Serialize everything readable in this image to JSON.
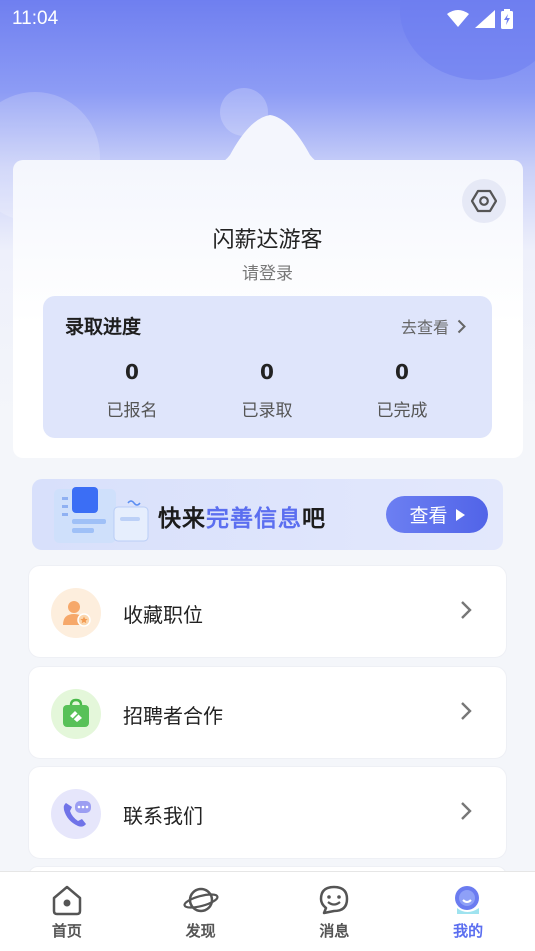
{
  "status_bar": {
    "time": "11:04"
  },
  "profile": {
    "username": "闪薪达游客",
    "login_hint": "请登录"
  },
  "progress": {
    "title": "录取进度",
    "link_label": "去查看",
    "stats": [
      {
        "value": "0",
        "label": "已报名"
      },
      {
        "value": "0",
        "label": "已录取"
      },
      {
        "value": "0",
        "label": "已完成"
      }
    ]
  },
  "banner": {
    "text_prefix": "快来",
    "text_highlight": "完善信息",
    "text_suffix": "吧",
    "button_label": "查看"
  },
  "menu": [
    {
      "label": "收藏职位",
      "icon": "person-star-icon"
    },
    {
      "label": "招聘者合作",
      "icon": "handshake-bag-icon"
    },
    {
      "label": "联系我们",
      "icon": "phone-chat-icon"
    }
  ],
  "tabs": [
    {
      "label": "首页",
      "icon": "home-icon"
    },
    {
      "label": "发现",
      "icon": "planet-icon"
    },
    {
      "label": "消息",
      "icon": "chat-smile-icon"
    },
    {
      "label": "我的",
      "icon": "profile-icon",
      "active": true
    }
  ],
  "colors": {
    "accent": "#5b6ef0",
    "header": "#6f7ff0",
    "panel": "#dfe5fb"
  }
}
